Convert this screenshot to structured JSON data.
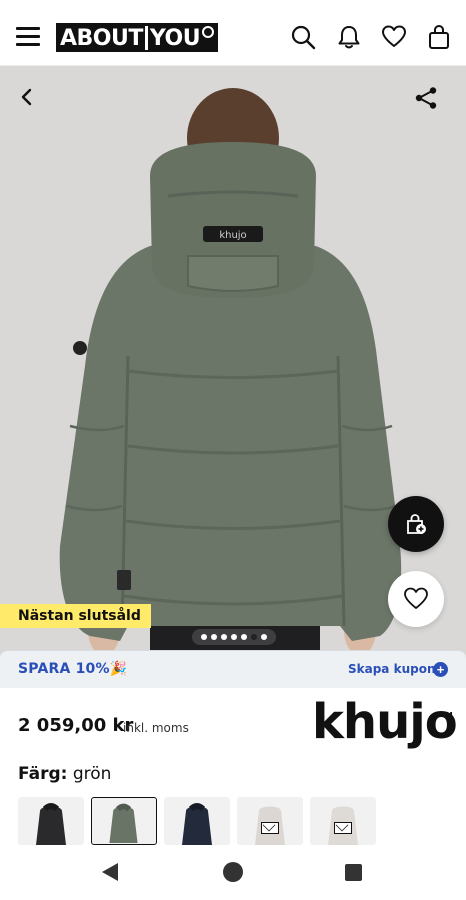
{
  "header": {
    "logo_left": "ABOUT",
    "logo_right": "YOU",
    "icons": [
      "menu-icon",
      "search-icon",
      "bell-icon",
      "heart-icon",
      "bag-icon"
    ]
  },
  "product": {
    "badge": "Nästan slutsåld",
    "image_count": 7,
    "active_image": 6,
    "hood_patch": "khujo"
  },
  "promo": {
    "left_text": "SPARA 10%🎉",
    "right_text": "Skapa kupong",
    "accent_color": "#2a4fb8"
  },
  "pricing": {
    "price": "2 059,00 kr",
    "note": "inkl. moms"
  },
  "brand": {
    "name": "khujo",
    "tm": "TM"
  },
  "color": {
    "label": "Färg:",
    "value": "grön",
    "swatches": [
      {
        "name": "black",
        "color": "#2a2a2c"
      },
      {
        "name": "green",
        "color": "#6a7466",
        "selected": true
      },
      {
        "name": "navy",
        "color": "#232a3c"
      },
      {
        "name": "beige",
        "color": "#dcd7d2"
      },
      {
        "name": "light-beige",
        "color": "#dedad6"
      }
    ]
  },
  "colors": {
    "jacket": "#6b7568",
    "background": "#d9d8d6",
    "badge": "#ffeb69"
  }
}
